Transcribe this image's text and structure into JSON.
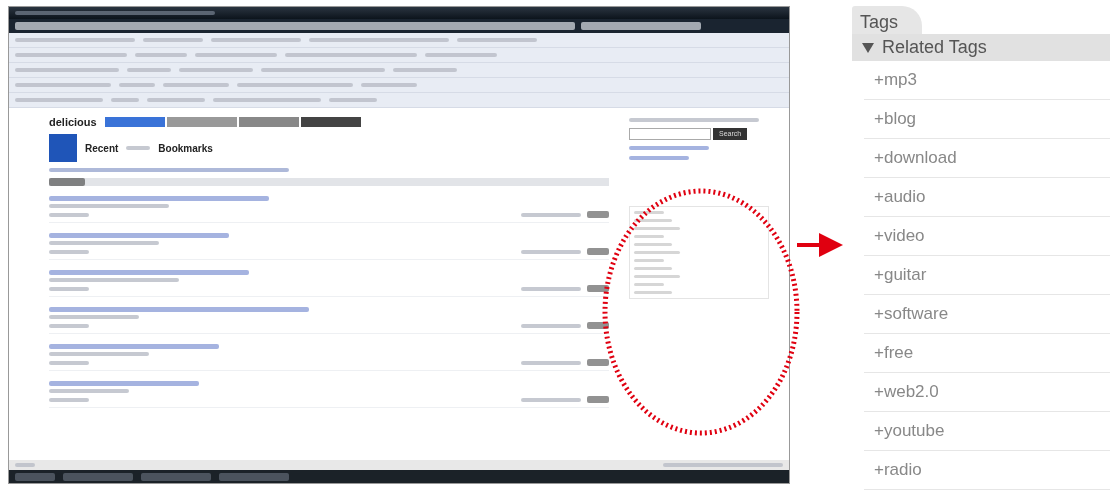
{
  "browser_screenshot": {
    "site_name": "delicious",
    "heading_first": "Recent",
    "heading_last": "Bookmarks",
    "search_button": "Search"
  },
  "tags_panel": {
    "tab": "Tags",
    "header": "Related Tags",
    "expanded": true,
    "tags": [
      "+mp3",
      "+blog",
      "+download",
      "+audio",
      "+video",
      "+guitar",
      "+software",
      "+free",
      "+web2.0",
      "+youtube",
      "+radio"
    ]
  }
}
